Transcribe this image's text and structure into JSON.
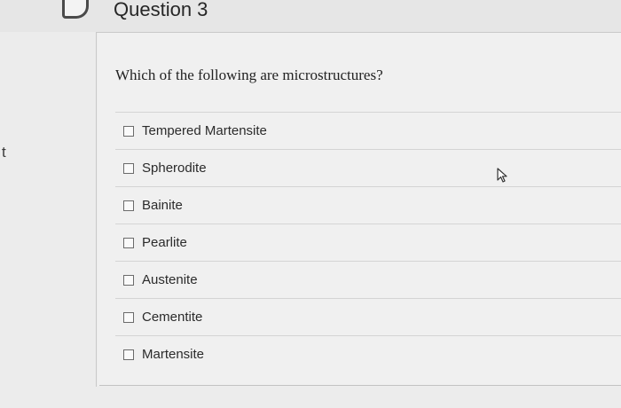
{
  "question": {
    "title": "Question 3",
    "prompt": "Which of the following are microstructures?"
  },
  "side_text": "t",
  "answers": [
    {
      "label": "Tempered Martensite",
      "checked": false
    },
    {
      "label": "Spherodite",
      "checked": false
    },
    {
      "label": "Bainite",
      "checked": false
    },
    {
      "label": "Pearlite",
      "checked": false
    },
    {
      "label": "Austenite",
      "checked": false
    },
    {
      "label": "Cementite",
      "checked": false
    },
    {
      "label": "Martensite",
      "checked": false
    }
  ],
  "icons": {
    "flag": "flag-icon",
    "cursor": "mouse-pointer-icon"
  }
}
